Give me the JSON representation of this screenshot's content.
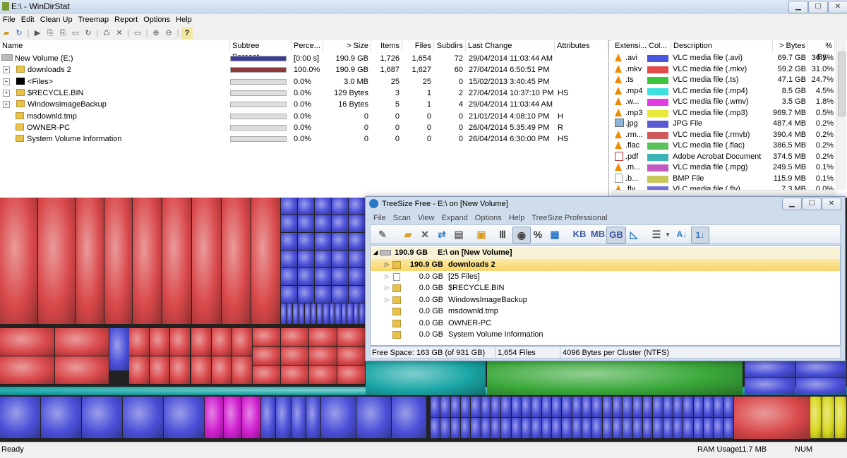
{
  "wds": {
    "title": "E:\\ - WinDirStat",
    "menu": [
      "File",
      "Edit",
      "Clean Up",
      "Treemap",
      "Report",
      "Options",
      "Help"
    ],
    "toolbar_icons": [
      "open-icon",
      "refresh-icon",
      "play-icon",
      "copy-icon",
      "copy-icon",
      "explorer-icon",
      "refresh-all-icon",
      "recycle-icon",
      "delete-icon",
      "properties-icon",
      "zoom-in-icon",
      "zoom-out-icon",
      "help-icon"
    ],
    "tree": {
      "headers": [
        "Name",
        "Subtree Percent...",
        "Perce...",
        "> Size",
        "Items",
        "Files",
        "Subdirs",
        "Last Change",
        "Attributes"
      ],
      "rows": [
        {
          "name": "New Volume (E:)",
          "pct": "[0:00 s]",
          "size": "190.9 GB",
          "items": "1,726",
          "files": "1,654",
          "subdirs": "72",
          "last": "29/04/2014 11:03:44 AM",
          "attr": "",
          "bar": 1.0,
          "barColor": "#3c3c96"
        },
        {
          "name": "downloads 2",
          "pct": "100.0%",
          "size": "190.9 GB",
          "items": "1,687",
          "files": "1,627",
          "subdirs": "60",
          "last": "27/04/2014 6:50:51 PM",
          "attr": "",
          "bar": 1.0,
          "barColor": "#8c3a3a"
        },
        {
          "name": "<Files>",
          "pct": "0.0%",
          "size": "3.0 MB",
          "items": "25",
          "files": "25",
          "subdirs": "0",
          "last": "15/02/2013 3:40:45 PM",
          "attr": "",
          "bar": 0,
          "barColor": "#888"
        },
        {
          "name": "$RECYCLE.BIN",
          "pct": "0.0%",
          "size": "129 Bytes",
          "items": "3",
          "files": "1",
          "subdirs": "2",
          "last": "27/04/2014 10:37:10 PM",
          "attr": "HS",
          "bar": 0,
          "barColor": "#888"
        },
        {
          "name": "WindowsImageBackup",
          "pct": "0.0%",
          "size": "16 Bytes",
          "items": "5",
          "files": "1",
          "subdirs": "4",
          "last": "29/04/2014 11:03:44 AM",
          "attr": "",
          "bar": 0,
          "barColor": "#888"
        },
        {
          "name": "msdownld.tmp",
          "pct": "0.0%",
          "size": "0",
          "items": "0",
          "files": "0",
          "subdirs": "0",
          "last": "21/01/2014 4:08:10 PM",
          "attr": "H",
          "bar": 0,
          "barColor": "#888"
        },
        {
          "name": "OWNER-PC",
          "pct": "0.0%",
          "size": "0",
          "items": "0",
          "files": "0",
          "subdirs": "0",
          "last": "26/04/2014 5:35:49 PM",
          "attr": "R",
          "bar": 0,
          "barColor": "#888"
        },
        {
          "name": "System Volume Information",
          "pct": "0.0%",
          "size": "0",
          "items": "0",
          "files": "0",
          "subdirs": "0",
          "last": "26/04/2014 6:30:00 PM",
          "attr": "HS",
          "bar": 0,
          "barColor": "#888"
        }
      ]
    },
    "ext": {
      "headers": [
        "Extensi...",
        "Col...",
        "Description",
        "> Bytes",
        "% By..."
      ],
      "rows": [
        {
          "ext": ".avi",
          "color": "#4a55e0",
          "desc": "VLC media file (.avi)",
          "bytes": "69.7 GB",
          "pct": "36.5%",
          "icon": "vlc"
        },
        {
          "ext": ".mkv",
          "color": "#e04a4a",
          "desc": "VLC media file (.mkv)",
          "bytes": "59.2 GB",
          "pct": "31.0%",
          "icon": "vlc"
        },
        {
          "ext": ".ts",
          "color": "#3ec43e",
          "desc": "VLC media file (.ts)",
          "bytes": "47.1 GB",
          "pct": "24.7%",
          "icon": "vlc"
        },
        {
          "ext": ".mp4",
          "color": "#3ee0e0",
          "desc": "VLC media file (.mp4)",
          "bytes": "8.5 GB",
          "pct": "4.5%",
          "icon": "vlc"
        },
        {
          "ext": ".w...",
          "color": "#e03ee0",
          "desc": "VLC media file (.wmv)",
          "bytes": "3.5 GB",
          "pct": "1.8%",
          "icon": "vlc"
        },
        {
          "ext": ".mp3",
          "color": "#e8e83a",
          "desc": "VLC media file (.mp3)",
          "bytes": "969.7 MB",
          "pct": "0.5%",
          "icon": "vlc"
        },
        {
          "ext": ".jpg",
          "color": "#5a5ad0",
          "desc": "JPG File",
          "bytes": "487.4 MB",
          "pct": "0.2%",
          "icon": "img"
        },
        {
          "ext": ".rm...",
          "color": "#d05a5a",
          "desc": "VLC media file (.rmvb)",
          "bytes": "390.4 MB",
          "pct": "0.2%",
          "icon": "vlc"
        },
        {
          "ext": ".flac",
          "color": "#5ac05a",
          "desc": "VLC media file (.flac)",
          "bytes": "386.5 MB",
          "pct": "0.2%",
          "icon": "vlc"
        },
        {
          "ext": ".pdf",
          "color": "#3ab4b4",
          "desc": "Adobe Acrobat Document",
          "bytes": "374.5 MB",
          "pct": "0.2%",
          "icon": "pdf"
        },
        {
          "ext": ".m...",
          "color": "#c05ac0",
          "desc": "VLC media file (.mpg)",
          "bytes": "249.5 MB",
          "pct": "0.1%",
          "icon": "vlc"
        },
        {
          "ext": ".b...",
          "color": "#c8c85a",
          "desc": "BMP File",
          "bytes": "115.9 MB",
          "pct": "0.1%",
          "icon": "file"
        },
        {
          "ext": ".flv",
          "color": "#7070d8",
          "desc": "VLC media file (.flv)",
          "bytes": "7.3 MB",
          "pct": "0.0%",
          "icon": "vlc"
        }
      ]
    },
    "status": {
      "left": "Ready",
      "ram_label": "RAM Usage:",
      "ram_value": "11.7 MB",
      "num": "NUM"
    }
  },
  "ts": {
    "title": "TreeSize Free - E:\\  on  [New Volume]",
    "menu": [
      "File",
      "Scan",
      "View",
      "Expand",
      "Options",
      "Help",
      "TreeSize Professional"
    ],
    "toolbar_units": [
      "KB",
      "MB",
      "GB"
    ],
    "root": {
      "size": "190.9 GB",
      "label": "E:\\  on  [New Volume]"
    },
    "rows": [
      {
        "size": "190.9 GB",
        "name": "downloads 2",
        "selected": true
      },
      {
        "size": "0.0 GB",
        "name": "[25 Files]",
        "selected": false
      },
      {
        "size": "0.0 GB",
        "name": "$RECYCLE.BIN",
        "selected": false
      },
      {
        "size": "0.0 GB",
        "name": "WindowsImageBackup",
        "selected": false
      },
      {
        "size": "0.0 GB",
        "name": "msdownld.tmp",
        "selected": false
      },
      {
        "size": "0.0 GB",
        "name": "OWNER-PC",
        "selected": false
      },
      {
        "size": "0.0 GB",
        "name": "System Volume Information",
        "selected": false
      }
    ],
    "status": {
      "free": "Free Space: 163 GB  (of 931 GB)",
      "files": "1,654  Files",
      "cluster": "4096 Bytes per Cluster (NTFS)"
    }
  }
}
